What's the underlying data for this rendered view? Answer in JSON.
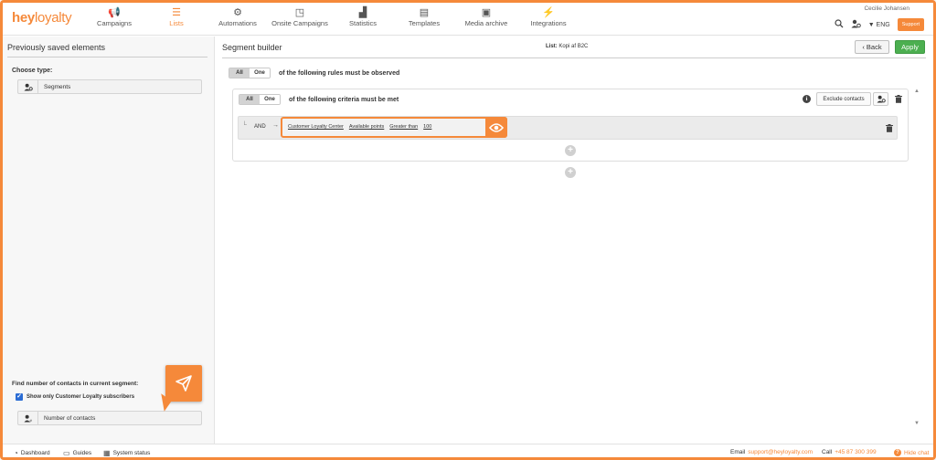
{
  "app": {
    "logo_main": "hey",
    "logo_accent": "loyalty",
    "user_name": "Cecilie Johansen",
    "language": "▼ ENG",
    "support_label": "Support"
  },
  "nav": [
    {
      "label": "Campaigns",
      "icon": "megaphone-icon",
      "glyph": "📢"
    },
    {
      "label": "Lists",
      "icon": "list-icon",
      "glyph": "☰"
    },
    {
      "label": "Automations",
      "icon": "automation-icon",
      "glyph": "⚙"
    },
    {
      "label": "Onsite Campaigns",
      "icon": "window-icon",
      "glyph": "◳"
    },
    {
      "label": "Statistics",
      "icon": "chart-icon",
      "glyph": "▟"
    },
    {
      "label": "Templates",
      "icon": "template-icon",
      "glyph": "▤"
    },
    {
      "label": "Media archive",
      "icon": "image-icon",
      "glyph": "▣"
    },
    {
      "label": "Integrations",
      "icon": "plug-icon",
      "glyph": "⚡"
    }
  ],
  "left": {
    "title": "Previously saved elements",
    "choose_type": "Choose type:",
    "segments_label": "Segments",
    "find_label": "Find number of contacts in current segment:",
    "checkbox_label": "Show only Customer Loyalty subscribers",
    "checkbox_checked": true,
    "number_button": "Number of contacts"
  },
  "main": {
    "title": "Segment builder",
    "list_prefix": "List:",
    "list_name": "Kopi af B2C",
    "back_label": "Back",
    "apply_label": "Apply",
    "outer_toggle": {
      "all": "All",
      "one": "One",
      "selected": "All"
    },
    "outer_rule_text": "of the following rules must be observed",
    "inner_toggle": {
      "all": "All",
      "one": "One",
      "selected": "All"
    },
    "inner_rule_text": "of the following criteria must be met",
    "exclude_label": "Exclude contacts",
    "criterion": {
      "connector": "AND",
      "source": "Customer Loyalty Center",
      "field": "Available points",
      "operator": "Greater than",
      "value": "100"
    }
  },
  "footer": {
    "dashboard": "Dashboard",
    "guides": "Guides",
    "system_status": "System status",
    "email_label": "Email",
    "email": "support@heyloyalty.com",
    "call_label": "Call",
    "phone": "+45 87 300 399",
    "hide_chat": "Hide chat"
  },
  "colors": {
    "accent": "#f5893a",
    "apply": "#4caf50",
    "checkbox": "#2b6cd4"
  }
}
